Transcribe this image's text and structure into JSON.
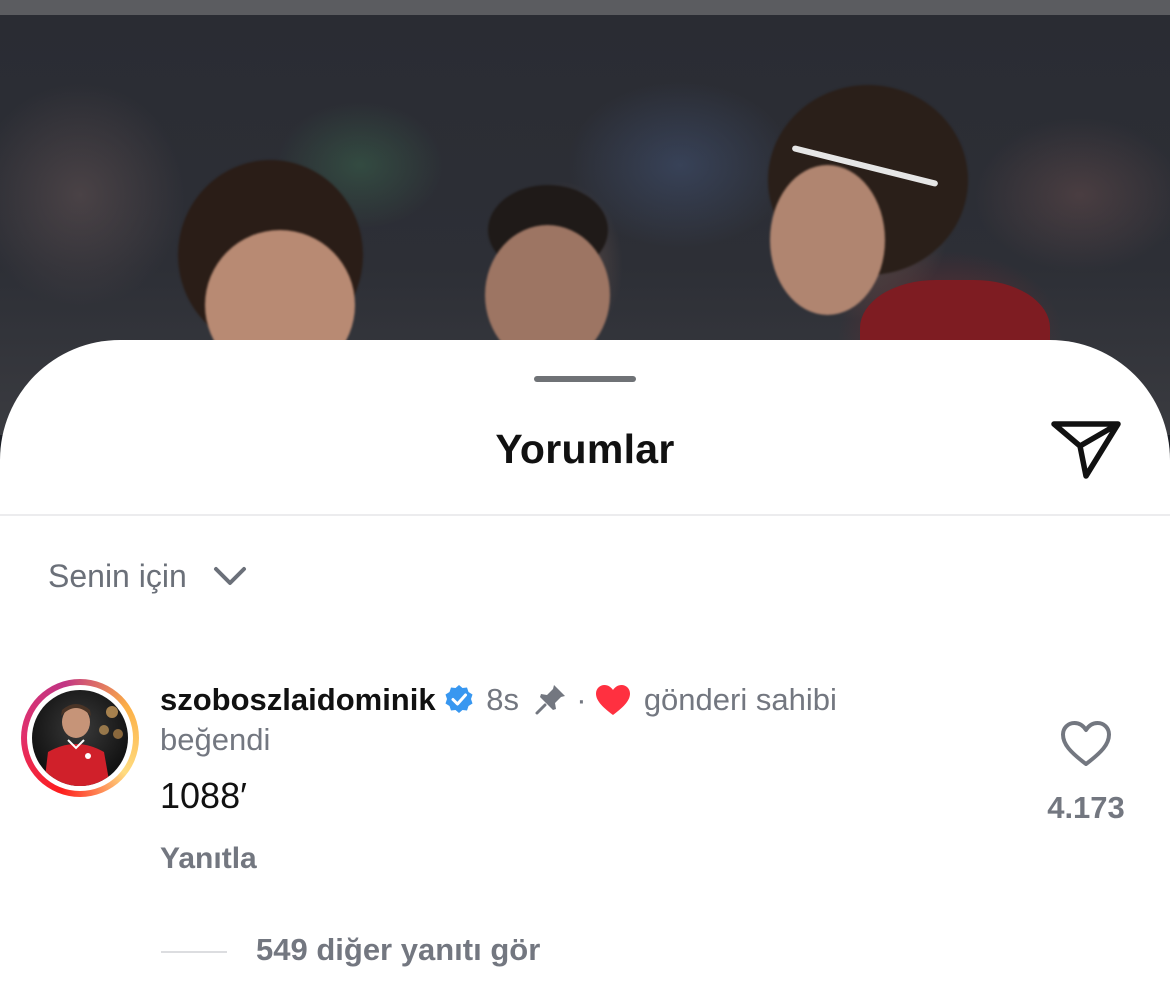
{
  "sheet": {
    "title": "Yorumlar"
  },
  "filter": {
    "label": "Senin için"
  },
  "comment": {
    "username": "szoboszlaidominik",
    "time": "8s",
    "separator": "·",
    "liked_by_author_line1": "gönderi sahibi",
    "liked_by_author_line2": "beğendi",
    "text": "1088′",
    "reply_label": "Yanıtla",
    "like_count": "4.173",
    "view_replies_label": "549 diğer yanıtı gör",
    "verified": true,
    "pinned": true
  },
  "icons": {
    "share": "paper-plane-icon",
    "chevron": "chevron-down-icon",
    "verified": "verified-badge-icon",
    "pin": "pin-icon",
    "author_like": "red-heart-icon",
    "like": "heart-outline-icon"
  },
  "colors": {
    "verified_blue": "#3897f0",
    "heart_red": "#ff3040",
    "secondary_text": "#737780"
  }
}
